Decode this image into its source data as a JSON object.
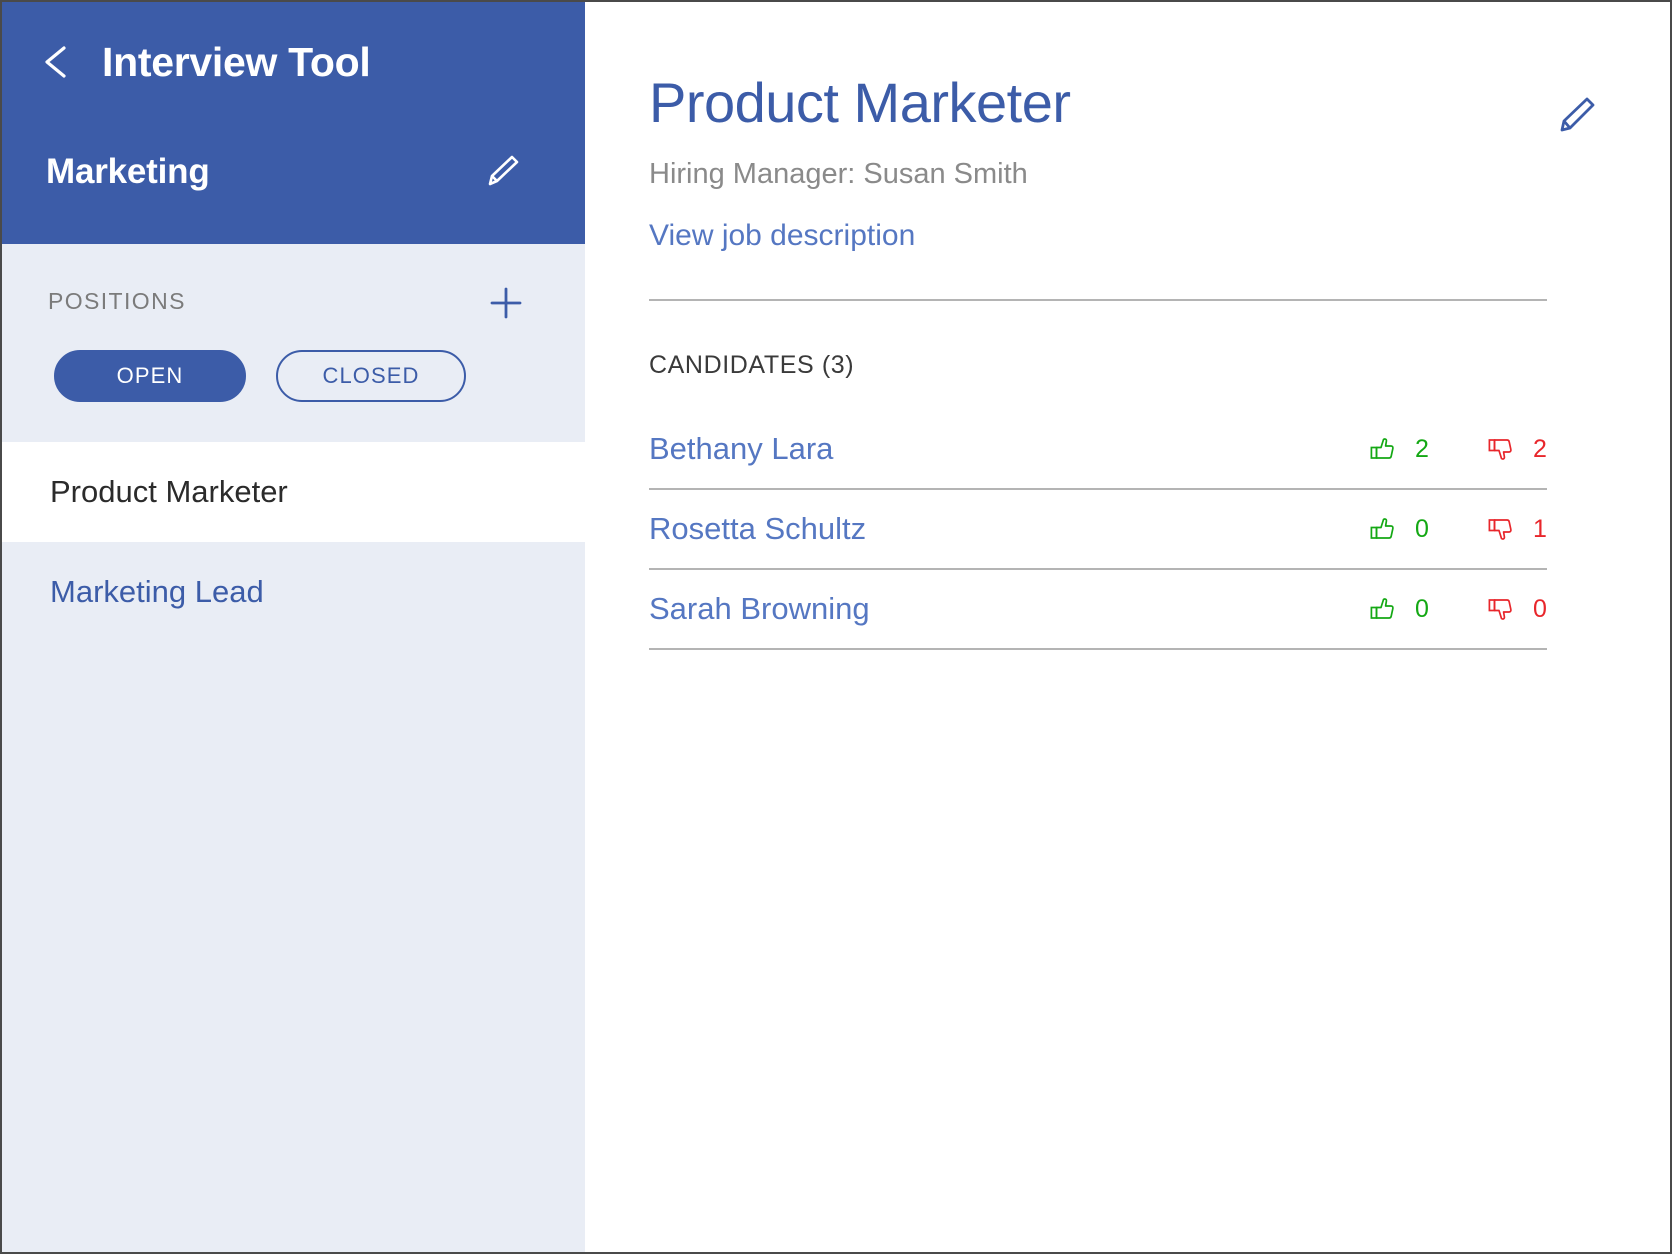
{
  "theme": {
    "brand_blue": "#3C5CA8",
    "link_blue": "#5577C2",
    "sidebar_bg": "#E9EDF5",
    "thumbs_up_green": "#14A814",
    "thumbs_down_red": "#E8262B",
    "muted_gray": "#8A8A8A"
  },
  "sidebar": {
    "back_icon": "chevron-left-icon",
    "app_title": "Interview Tool",
    "department": "Marketing",
    "department_edit_icon": "pencil-icon",
    "positions_label": "POSITIONS",
    "add_icon": "plus-icon",
    "filters": [
      {
        "label": "OPEN",
        "active": true
      },
      {
        "label": "CLOSED",
        "active": false
      }
    ],
    "positions": [
      {
        "label": "Product Marketer",
        "active": true
      },
      {
        "label": "Marketing Lead",
        "active": false
      }
    ]
  },
  "main": {
    "job_title": "Product Marketer",
    "edit_icon": "pencil-icon",
    "hiring_manager": "Hiring Manager: Susan Smith",
    "job_description_link": "View job description",
    "candidates_header": "CANDIDATES (3)",
    "thumbs_up_icon": "thumbs-up-icon",
    "thumbs_down_icon": "thumbs-down-icon",
    "candidates": [
      {
        "name": "Bethany Lara",
        "up": "2",
        "down": "2"
      },
      {
        "name": "Rosetta Schultz",
        "up": "0",
        "down": "1"
      },
      {
        "name": "Sarah Browning",
        "up": "0",
        "down": "0"
      }
    ]
  }
}
